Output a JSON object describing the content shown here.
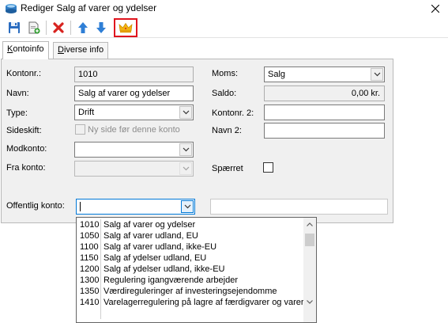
{
  "window": {
    "title": "Rediger Salg af varer og ydelser"
  },
  "toolbar": {
    "icons": [
      "save-icon",
      "save-new-icon",
      "delete-icon",
      "arrow-up-icon",
      "arrow-down-icon",
      "crown-icon"
    ]
  },
  "tabs": [
    {
      "label_u": "K",
      "label_rest": "ontoinfo"
    },
    {
      "label_u": "D",
      "label_rest": "iverse info"
    }
  ],
  "form": {
    "kontonr_label": "Kontonr.:",
    "kontonr_value": "1010",
    "navn_label": "Navn:",
    "navn_value": "Salg af varer og ydelser",
    "type_label": "Type:",
    "type_value": "Drift",
    "sideskift_label": "Sideskift:",
    "ny_side_label": "Ny side før denne konto",
    "modkonto_label": "Modkonto:",
    "modkonto_value": "",
    "frakonto_label": "Fra konto:",
    "frakonto_value": "",
    "moms_label": "Moms:",
    "moms_value": "Salg",
    "saldo_label": "Saldo:",
    "saldo_value": "0,00 kr.",
    "kontonr2_label": "Kontonr. 2:",
    "kontonr2_value": "",
    "navn2_label": "Navn 2:",
    "navn2_value": "",
    "spaerret_label": "Spærret",
    "offentlig_label": "Offentlig konto:",
    "offentlig_value": "",
    "offentlig_name_value": ""
  },
  "dropdown": {
    "items": [
      {
        "code": "1010",
        "name": "Salg af varer og ydelser"
      },
      {
        "code": "1050",
        "name": "Salg af varer udland, EU"
      },
      {
        "code": "1100",
        "name": "Salg af varer udland, ikke-EU"
      },
      {
        "code": "1150",
        "name": "Salg af ydelser udland, EU"
      },
      {
        "code": "1200",
        "name": "Salg af ydelser udland, ikke-EU"
      },
      {
        "code": "1300",
        "name": "Regulering igangværende arbejder"
      },
      {
        "code": "1350",
        "name": "Værdireguleringer af investeringsejendomme"
      },
      {
        "code": "1410",
        "name": "Varelagerregulering på lagre af færdigvarer og varer"
      },
      {
        "code": "",
        "name": ""
      }
    ]
  }
}
